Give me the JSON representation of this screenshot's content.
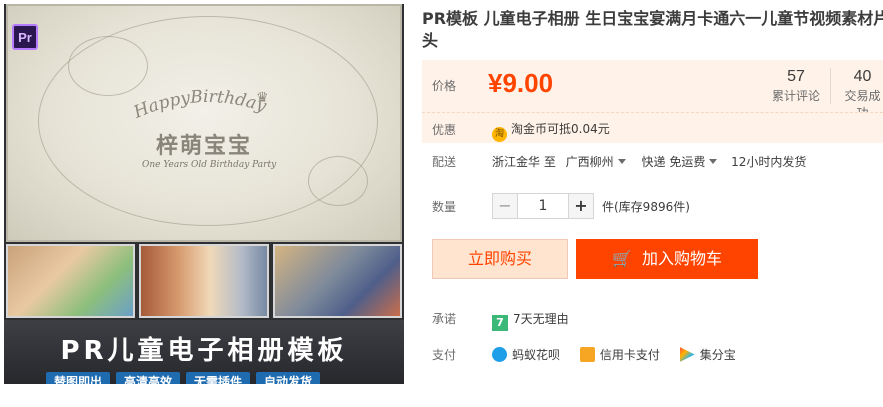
{
  "gallery": {
    "pr_badge": "Pr",
    "main_image": {
      "greeting": "HappyBirthday",
      "name": "梓萌宝宝",
      "subtitle": "One Years Old Birthday Party"
    },
    "banner": {
      "title": "PR儿童电子相册模板",
      "tags": [
        "替图即出",
        "高清高效",
        "无需插件",
        "自动发货"
      ]
    }
  },
  "product": {
    "title": "PR模板 儿童电子相册 生日宝宝宴满月卡通六一儿童节视频素材片",
    "title_wrap": "头",
    "price_label": "价格",
    "price": "¥9.00",
    "review_count": "57",
    "review_label": "累计评论",
    "deal_count": "40",
    "deal_label": "交易成功",
    "promo_label": "优惠",
    "promo_icon": "淘",
    "promo_text": "淘金币可抵0.04元",
    "ship_label": "配送",
    "ship_from": "浙江金华 至",
    "ship_to": "广西柳州",
    "ship_method": "快递 免运费",
    "ship_time": "12小时内发货",
    "qty_label": "数量",
    "qty_minus": "−",
    "qty_value": "1",
    "qty_plus": "+",
    "stock": "件(库存9896件)",
    "buy_now": "立即购买",
    "add_cart": "加入购物车",
    "promise_label": "承诺",
    "promise_icon": "7",
    "promise_text": "7天无理由",
    "pay_label": "支付",
    "pay_methods": [
      "蚂蚁花呗",
      "信用卡支付",
      "集分宝"
    ]
  },
  "colors": {
    "accent": "#ff4400",
    "price_bg": "#fff2e8",
    "buy_bg": "#ffe4d0"
  }
}
